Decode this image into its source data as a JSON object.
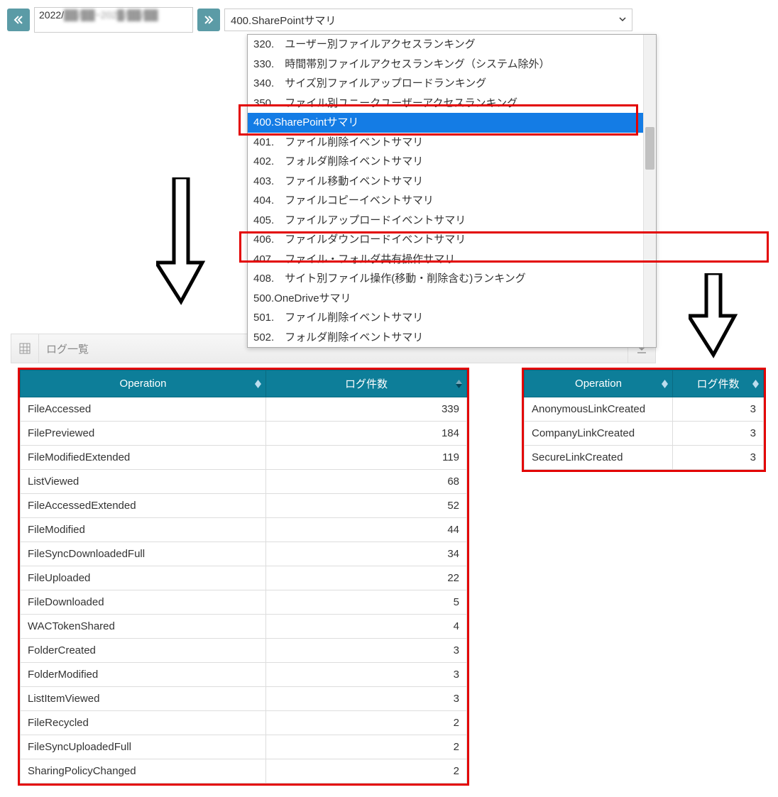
{
  "toolbar": {
    "date_range": "2022/",
    "date_range_blur": "██/██~202█/██/██",
    "selected_value": "400.SharePointサマリ"
  },
  "dropdown": {
    "items": [
      {
        "label": "320.　ユーザー別ファイルアクセスランキング"
      },
      {
        "label": "330.　時間帯別ファイルアクセスランキング（システム除外）"
      },
      {
        "label": "340.　サイズ別ファイルアップロードランキング"
      },
      {
        "label": "350.　ファイル別ユニークユーザーアクセスランキング"
      },
      {
        "label": "400.SharePointサマリ",
        "selected": true
      },
      {
        "label": "401.　ファイル削除イベントサマリ"
      },
      {
        "label": "402.　フォルダ削除イベントサマリ"
      },
      {
        "label": "403.　ファイル移動イベントサマリ"
      },
      {
        "label": "404.　ファイルコピーイベントサマリ"
      },
      {
        "label": "405.　ファイルアップロードイベントサマリ"
      },
      {
        "label": "406.　ファイルダウンロードイベントサマリ"
      },
      {
        "label": "407.　ファイル・フォルダ共有操作サマリ"
      },
      {
        "label": "408.　サイト別ファイル操作(移動・削除含む)ランキング"
      },
      {
        "label": "500.OneDriveサマリ"
      },
      {
        "label": "501.　ファイル削除イベントサマリ"
      },
      {
        "label": "502.　フォルダ削除イベントサマリ"
      }
    ]
  },
  "panel": {
    "title": "ログ一覧"
  },
  "table_left": {
    "columns": [
      "Operation",
      "ログ件数"
    ],
    "rows": [
      {
        "op": "FileAccessed",
        "count": "339"
      },
      {
        "op": "FilePreviewed",
        "count": "184"
      },
      {
        "op": "FileModifiedExtended",
        "count": "119"
      },
      {
        "op": "ListViewed",
        "count": "68"
      },
      {
        "op": "FileAccessedExtended",
        "count": "52"
      },
      {
        "op": "FileModified",
        "count": "44"
      },
      {
        "op": "FileSyncDownloadedFull",
        "count": "34"
      },
      {
        "op": "FileUploaded",
        "count": "22"
      },
      {
        "op": "FileDownloaded",
        "count": "5"
      },
      {
        "op": "WACTokenShared",
        "count": "4"
      },
      {
        "op": "FolderCreated",
        "count": "3"
      },
      {
        "op": "FolderModified",
        "count": "3"
      },
      {
        "op": "ListItemViewed",
        "count": "3"
      },
      {
        "op": "FileRecycled",
        "count": "2"
      },
      {
        "op": "FileSyncUploadedFull",
        "count": "2"
      },
      {
        "op": "SharingPolicyChanged",
        "count": "2"
      }
    ]
  },
  "table_right": {
    "columns": [
      "Operation",
      "ログ件数"
    ],
    "rows": [
      {
        "op": "AnonymousLinkCreated",
        "count": "3"
      },
      {
        "op": "CompanyLinkCreated",
        "count": "3"
      },
      {
        "op": "SecureLinkCreated",
        "count": "3"
      }
    ]
  }
}
